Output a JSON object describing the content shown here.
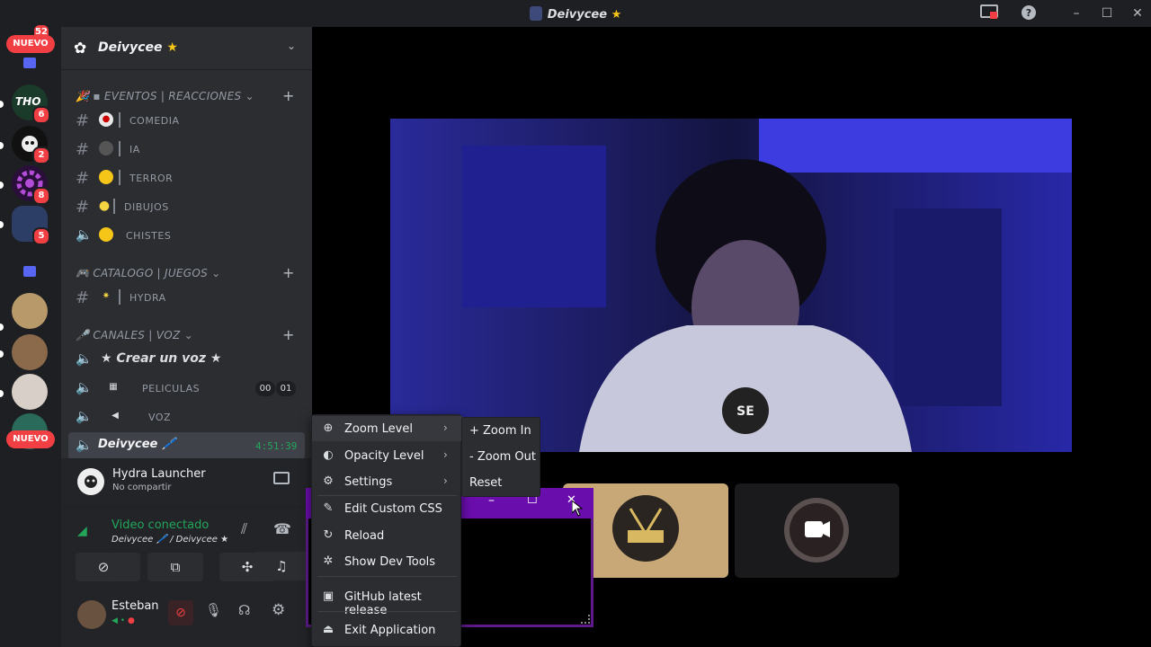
{
  "window": {
    "title": "Deivycee",
    "title_star": "★",
    "minimize": "–",
    "maximize": "☐",
    "close": "✕"
  },
  "guilds": {
    "nuevo_top": "NUEVO",
    "nuevo_bottom": "NUEVO",
    "top_badge": "52",
    "badges": [
      "6",
      "2",
      "8",
      "5"
    ],
    "tho_label": "THO"
  },
  "server": {
    "name": "Deivycee",
    "name_star": "★"
  },
  "categories": [
    {
      "label": "▪ EVENTOS | REACCIONES ⌄",
      "emoji": "🎉"
    },
    {
      "label": "CATALOGO | JUEGOS ⌄",
      "emoji": "🎮"
    },
    {
      "label": "CANALES | VOZ ⌄",
      "emoji": "🎤"
    }
  ],
  "channels": {
    "comedia": "COMEDIA",
    "ia": "IA",
    "terror": "TERROR",
    "dibujos": "DIBUJOS",
    "chistes": "CHISTES",
    "hydra": "HYDRA",
    "crear_voz": "★ Crear un voz ★",
    "peliculas": "PELICULAS",
    "peliculas_count_a": "00",
    "peliculas_count_b": "01",
    "voz": "VOZ",
    "deivycee": "Deivycee 🖊️",
    "deivycee_timer": "4:51:39"
  },
  "activity": {
    "app_name": "Hydra Launcher",
    "status": "No compartir"
  },
  "voice": {
    "status": "Video conectado",
    "channel": "Deivycee 🖊️ / Deivycee ★"
  },
  "user": {
    "name": "Esteban"
  },
  "context_menu": {
    "items": [
      {
        "label": "Zoom Level",
        "icon": "zoom-icon"
      },
      {
        "label": "Opacity Level",
        "icon": "opacity-icon"
      },
      {
        "label": "Settings",
        "icon": "gear-icon"
      },
      {
        "label": "Edit Custom CSS",
        "icon": "edit-icon"
      },
      {
        "label": "Reload",
        "icon": "reload-icon"
      },
      {
        "label": "Show Dev Tools",
        "icon": "bug-icon"
      },
      {
        "label": "GitHub latest release",
        "icon": "github-icon"
      },
      {
        "label": "Exit Application",
        "icon": "exit-icon"
      }
    ]
  },
  "zoom_submenu": {
    "items": [
      "+ Zoom In",
      "- Zoom Out",
      "Reset"
    ]
  },
  "pip": {
    "minimize": "–",
    "maximize": "☐",
    "close": "✕"
  },
  "colors": {
    "accent": "#5865f2",
    "danger": "#f23f43",
    "voice_green": "#23a55a",
    "pip_purple": "#6a0dad",
    "tile_tan": "#c8a877"
  }
}
